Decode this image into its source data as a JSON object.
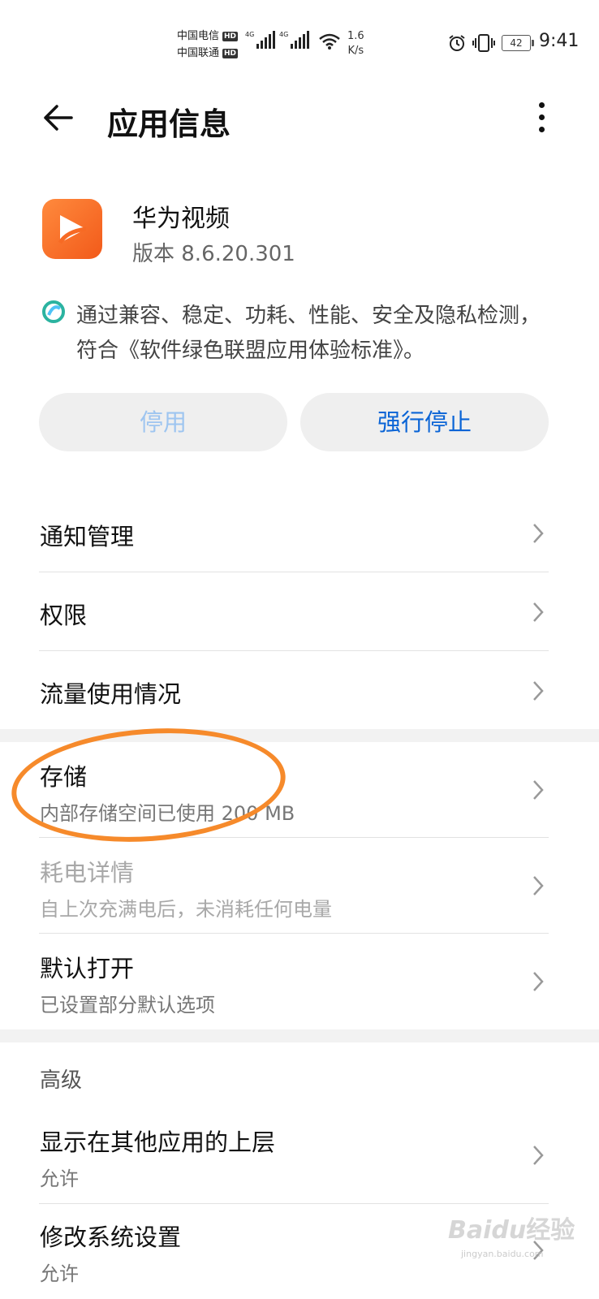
{
  "status_bar": {
    "carrier1": "中国电信",
    "carrier2": "中国联通",
    "hd": "HD",
    "network": "4G",
    "speed_value": "1.6",
    "speed_unit": "K/s",
    "battery": "42",
    "time": "9:41"
  },
  "header": {
    "title": "应用信息"
  },
  "app": {
    "name": "华为视频",
    "version": "版本 8.6.20.301",
    "icon": "huawei-video-play-icon",
    "icon_color": "#f76a24"
  },
  "certification": {
    "text": "通过兼容、稳定、功耗、性能、安全及隐私检测，符合《软件绿色联盟应用体验标准》。"
  },
  "buttons": {
    "disable": "停用",
    "force_stop": "强行停止"
  },
  "colors": {
    "accent": "#0a64d6",
    "disabled_text": "#9ec5f0",
    "highlight": "#f68a2b"
  },
  "items": {
    "notifications": "通知管理",
    "permissions": "权限",
    "data_usage": "流量使用情况",
    "storage": {
      "title": "存储",
      "subtitle": "内部存储空间已使用 200 MB"
    },
    "battery": {
      "title": "耗电详情",
      "subtitle": "自上次充满电后，未消耗任何电量"
    },
    "default_open": {
      "title": "默认打开",
      "subtitle": "已设置部分默认选项"
    },
    "section_advanced": "高级",
    "overlay": {
      "title": "显示在其他应用的上层",
      "subtitle": "允许"
    },
    "modify_settings": {
      "title": "修改系统设置",
      "subtitle": "允许"
    }
  },
  "watermark": {
    "brand": "Bai",
    "brand2": "du",
    "cn": "经验",
    "url": "jingyan.baidu.com"
  }
}
